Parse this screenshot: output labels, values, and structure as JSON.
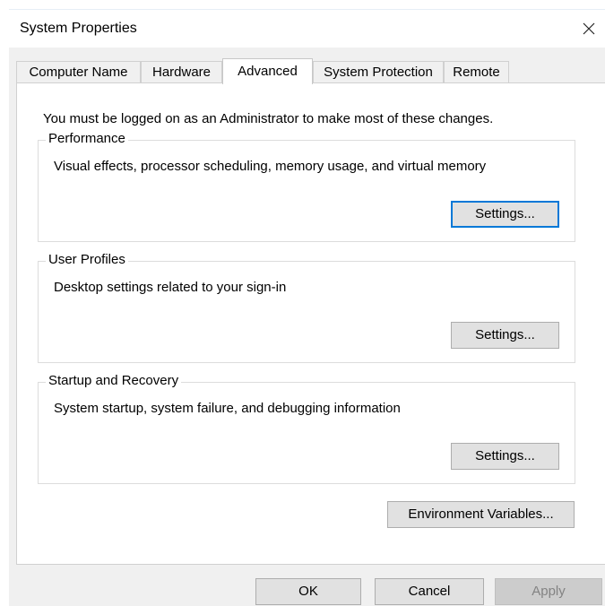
{
  "window": {
    "title": "System Properties",
    "close_icon": "close-icon"
  },
  "tabs": [
    {
      "label": "Computer Name",
      "active": false
    },
    {
      "label": "Hardware",
      "active": false
    },
    {
      "label": "Advanced",
      "active": true
    },
    {
      "label": "System Protection",
      "active": false
    },
    {
      "label": "Remote",
      "active": false
    }
  ],
  "advanced": {
    "admin_note": "You must be logged on as an Administrator to make most of these changes.",
    "performance": {
      "label": "Performance",
      "description": "Visual effects, processor scheduling, memory usage, and virtual memory",
      "button": "Settings..."
    },
    "user_profiles": {
      "label": "User Profiles",
      "description": "Desktop settings related to your sign-in",
      "button": "Settings..."
    },
    "startup_recovery": {
      "label": "Startup and Recovery",
      "description": "System startup, system failure, and debugging information",
      "button": "Settings..."
    },
    "env_button": "Environment Variables..."
  },
  "footer": {
    "ok": "OK",
    "cancel": "Cancel",
    "apply": "Apply"
  },
  "colors": {
    "default_button_border": "#0078d7",
    "dialog_background": "#f0f0f0"
  }
}
